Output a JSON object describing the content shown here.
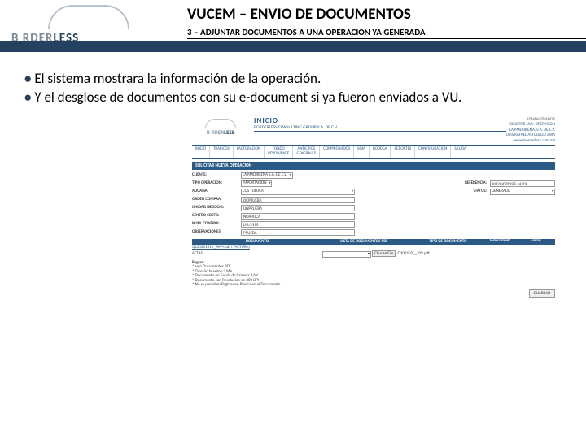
{
  "header": {
    "logo_gray": "B   RDER",
    "logo_dark": "LESS",
    "title": "VUCEM – ENVIO DE DOCUMENTOS",
    "subtitle": "3 – ADJUNTAR DOCUMENTOS A UNA OPERACION YA GENERADA"
  },
  "bullets": [
    "El sistema mostrara la información de la operación.",
    "Y el desglose de documentos con su e-document si ya fueron enviados a VU."
  ],
  "app": {
    "logo_gray": "B   RDER",
    "logo_dark": "LESS",
    "title": "INICIO",
    "company": "BORDERLESS CONSULTING GROUP S.A. DE C.V.",
    "right": {
      "admin": "ADMINISTRADOR",
      "l1": "SOLICITAR NVA. OPERACION",
      "l2": "LA MADRILEÑA, S.A. DE C.V.",
      "l3": "LUIS RAFAEL ASTUDILLO JARA",
      "l4": "www.borderless.com.mx"
    },
    "tabs": [
      "INICIO",
      "TRAFICOS",
      "FACTURACION",
      "FONDO\nREVOLVENTE",
      "ANTICIPOS\nGENERALES",
      "COMPROBADOS",
      "SOIA",
      "BODEGA",
      "REPORTES",
      "CONFIGURACION",
      "SALIDA"
    ],
    "section": "SOLICITAR NUEVA OPERACION",
    "form": {
      "cliente_label": "CLIENTE:",
      "cliente": "LA MADRILEÑA S.A. DE C.V.",
      "tipo_label": "TIPO OPERACION:",
      "tipo": "IMPORTACION",
      "ref_label": "REFERENCIA:",
      "ref": "IIIII20/001397-14/19",
      "aduana_label": "ADUANA:",
      "aduana": "COS TOLUCA",
      "status_label": "STATUS:",
      "status": "GENERADA",
      "ordenc_label": "ORDEN COMPRA:",
      "ordenc": "OCPRUEBA",
      "unidad_label": "UNIDAD NEGOCIO:",
      "unidad": "UNPRUEBA",
      "centro_label": "CENTRO COSTO:",
      "centro": "NOAPLICA",
      "control_label": "NUM. CONTROL:",
      "control": "LM/2995",
      "observ_label": "OBSERVACIONES:",
      "observ": "PRUEBA"
    },
    "docs": {
      "h_doc": "DOCUMENTO",
      "h_list": "LISTA DE DOCUMENTOS PDF",
      "h_tipo": "TIPO DE DOCUMENTO",
      "h_edoc": "E-document",
      "h_send": "Enviar",
      "rows": [
        {
          "doc": "Q100201412_9844.pdf ( FACTURA)",
          "sel": "",
          "file": "",
          "edoc": "",
          "send": ""
        },
        {
          "doc": "ACTAS",
          "sel": "",
          "btn": "Choose File",
          "file": "Q102102__329.pdf",
          "edoc": "",
          "send": ""
        }
      ]
    },
    "rules": {
      "heading": "Reglas:",
      "items": [
        "solo Documentos PDF",
        "Tamaño Maximo 3 Mb",
        "Documento en Escala de Grises a B/W",
        "Documento con Resolucion de 300 DPI",
        "No se permiten Paginas en Blanco en el Documento"
      ]
    },
    "guardar": "GUARDAR"
  }
}
